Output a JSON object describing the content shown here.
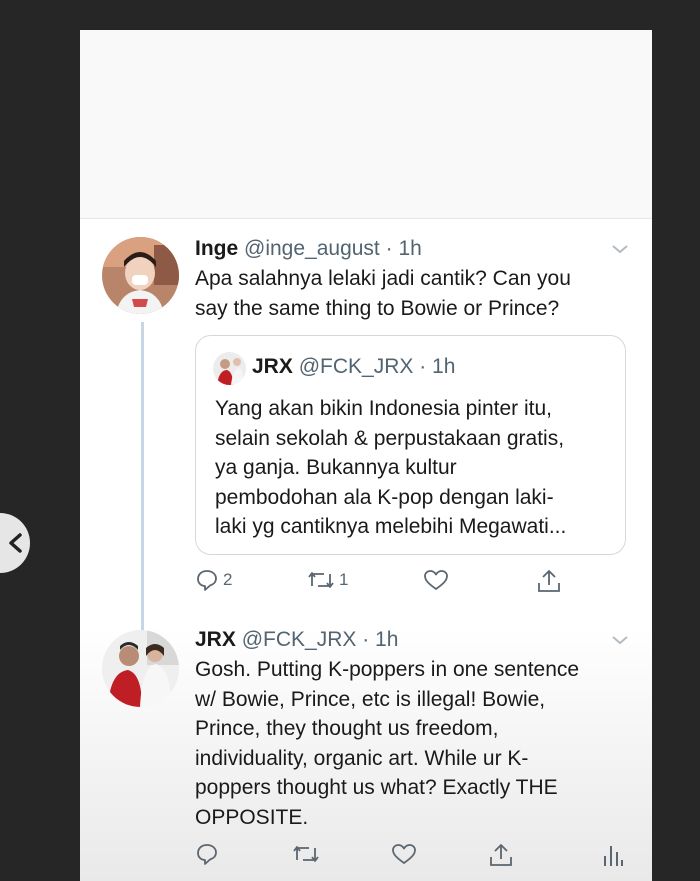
{
  "tweets": [
    {
      "name": "Inge",
      "handle": "@inge_august",
      "time": "· 1h",
      "text": [
        "Apa salahnya lelaki jadi cantik? Can you",
        "say the same thing to Bowie or Prince?"
      ],
      "reply_count": "2",
      "retweet_count": "1"
    },
    {
      "name": "JRX",
      "handle": "@FCK_JRX",
      "time": "· 1h",
      "text": [
        "Gosh. Putting K-poppers in one sentence",
        "w/ Bowie, Prince, etc is illegal! Bowie,",
        "Prince, they thought us freedom,",
        "individuality, organic art. While ur K-",
        "poppers thought us what? Exactly THE",
        "OPPOSITE."
      ]
    }
  ],
  "quote": {
    "name": "JRX",
    "handle": "@FCK_JRX",
    "time": "· 1h",
    "text": [
      "Yang akan bikin Indonesia pinter itu,",
      "selain sekolah & perpustakaan gratis,",
      "ya ganja. Bukannya kultur",
      "pembodohan ala K-pop dengan laki-",
      "laki yg cantiknya melebihi Megawati..."
    ]
  },
  "icons": {
    "reply": "reply-icon",
    "retweet": "retweet-icon",
    "like": "heart-icon",
    "share": "share-icon",
    "analytics": "analytics-icon",
    "more": "chevron-down-icon",
    "back": "back-arrow-icon"
  },
  "colors": {
    "text": "#1a1a1a",
    "meta": "#536471",
    "thread_line": "#c7d6e4",
    "background": "#262626"
  }
}
